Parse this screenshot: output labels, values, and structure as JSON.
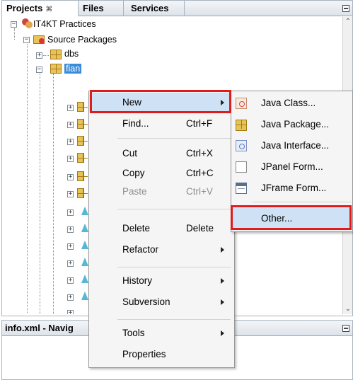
{
  "tabs": {
    "projects": "Projects",
    "projects_close": "⌘",
    "files": "Files",
    "services": "Services"
  },
  "tree": {
    "root": "IT4KT Practices",
    "source_packages": "Source Packages",
    "pkg_dbs": "dbs",
    "pkg_selected": "fian"
  },
  "navigator": {
    "title": "info.xml - Navig"
  },
  "context_menu": {
    "new": "New",
    "find": "Find...",
    "find_sc": "Ctrl+F",
    "cut": "Cut",
    "cut_sc": "Ctrl+X",
    "copy": "Copy",
    "copy_sc": "Ctrl+C",
    "paste": "Paste",
    "paste_sc": "Ctrl+V",
    "delete": "Delete",
    "delete_sc": "Delete",
    "refactor": "Refactor",
    "history": "History",
    "subversion": "Subversion",
    "tools": "Tools",
    "properties": "Properties"
  },
  "submenu": {
    "java_class": "Java Class...",
    "java_package": "Java Package...",
    "java_interface": "Java Interface...",
    "jpanel_form": "JPanel Form...",
    "jframe_form": "JFrame Form...",
    "other": "Other..."
  },
  "colors": {
    "highlight_box": "#e01b1b",
    "hover": "#cfe2f5",
    "selection": "#3a8bd8"
  }
}
